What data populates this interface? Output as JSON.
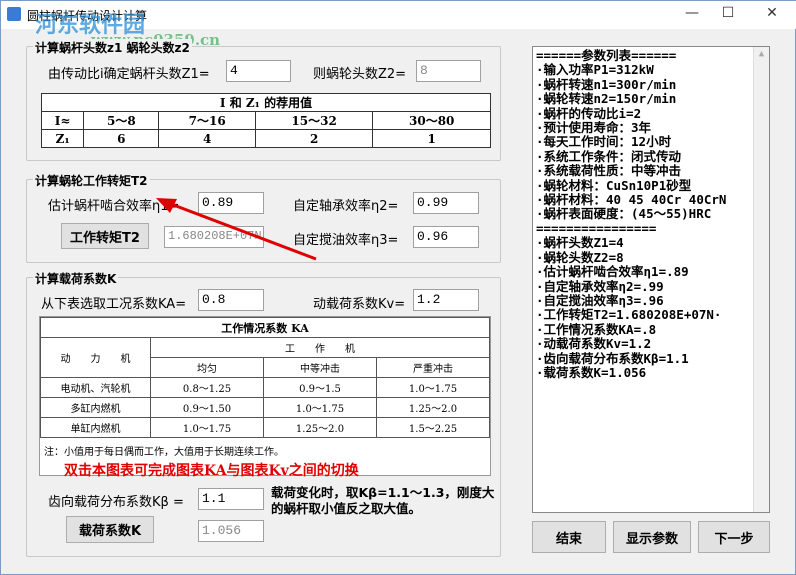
{
  "window": {
    "title": "圆柱蜗杆传动设计计算",
    "watermark": "河东软件园",
    "watermark_url": "www.pc0359.cn",
    "minimize": "—",
    "maximize": "☐",
    "close": "✕"
  },
  "group1": {
    "title": "计算蜗杆头数z1 蜗轮头数z2",
    "z1_label": "由传动比i确定蜗杆头数Z1=",
    "z1_value": "4",
    "z2_label": "则蜗轮头数Z2=",
    "z2_value": "8",
    "table": {
      "title": "I 和 Z₁ 的荐用值",
      "rows": [
        [
          "I≈",
          "5～8",
          "7～16",
          "15～32",
          "30～80"
        ],
        [
          "Z₁",
          "6",
          "4",
          "2",
          "1"
        ]
      ]
    }
  },
  "group2": {
    "title": "计算蜗轮工作转矩T2",
    "eta1_label": "估计蜗杆啮合效率η1=",
    "eta1_value": "0.89",
    "eta2_label": "自定轴承效率η2=",
    "eta2_value": "0.99",
    "torque_button": "工作转矩T2",
    "torque_value": "1.680208E+07N",
    "eta3_label": "自定搅油效率η3=",
    "eta3_value": "0.96"
  },
  "group3": {
    "title": "计算载荷系数K",
    "ka_label": "从下表选取工况系数KA=",
    "ka_value": "0.8",
    "kv_label": "动载荷系数Kv=",
    "kv_value": "1.2",
    "table": {
      "title": "工作情况系数 KA",
      "col_driver": "动　　力　　机",
      "col_driven": "工　　作　　机",
      "sub_cols": [
        "均匀",
        "中等冲击",
        "严重冲击"
      ],
      "rows": [
        [
          "电动机、汽轮机",
          "0.8～1.25",
          "0.9～1.5",
          "1.0～1.75"
        ],
        [
          "多缸内燃机",
          "0.9～1.50",
          "1.0～1.75",
          "1.25～2.0"
        ],
        [
          "单缸内燃机",
          "1.0～1.75",
          "1.25～2.0",
          "1.5～2.25"
        ]
      ],
      "note": "注：小值用于每日偶而工作，大值用于长期连续工作。",
      "hint": "双击本图表可完成图表KA与图表Kv之间的切换"
    },
    "kb_label": "齿向载荷分布系数Kβ =",
    "kb_value": "1.1",
    "kb_note": "载荷变化时，取Kβ=1.1～1.3，刚度大的蜗杆取小值反之取大值。",
    "k_button": "载荷系数K",
    "k_value": "1.056"
  },
  "param_list": [
    "======参数列表======",
    "·输入功率P1=312kW",
    "·蜗杆转速n1=300r/min",
    "·蜗轮转速n2=150r/min",
    "·蜗杆的传动比i=2",
    "·预计使用寿命：3年",
    "·每天工作时间：12小时",
    "·系统工作条件：闭式传动",
    "·系统载荷性质：中等冲击",
    "·蜗轮材料：CuSn10P1砂型",
    "·蜗杆材料：40 45 40Cr 40CrN",
    "·蜗杆表面硬度：(45～55)HRC",
    "================",
    "·蜗杆头数Z1=4",
    "·蜗轮头数Z2=8",
    "·估计蜗杆啮合效率η1=.89",
    "·自定轴承效率η2=.99",
    "·自定搅油效率η3=.96",
    "·工作转矩T2=1.680208E+07N·",
    "·工作情况系数KA=.8",
    "·动载荷系数Kv=1.2",
    "·齿向载荷分布系数Kβ=1.1",
    "·载荷系数K=1.056"
  ],
  "buttons": {
    "end": "结束",
    "show": "显示参数",
    "next": "下一步"
  },
  "colors": {
    "hint": "#e00000",
    "arrow": "#e00000"
  }
}
